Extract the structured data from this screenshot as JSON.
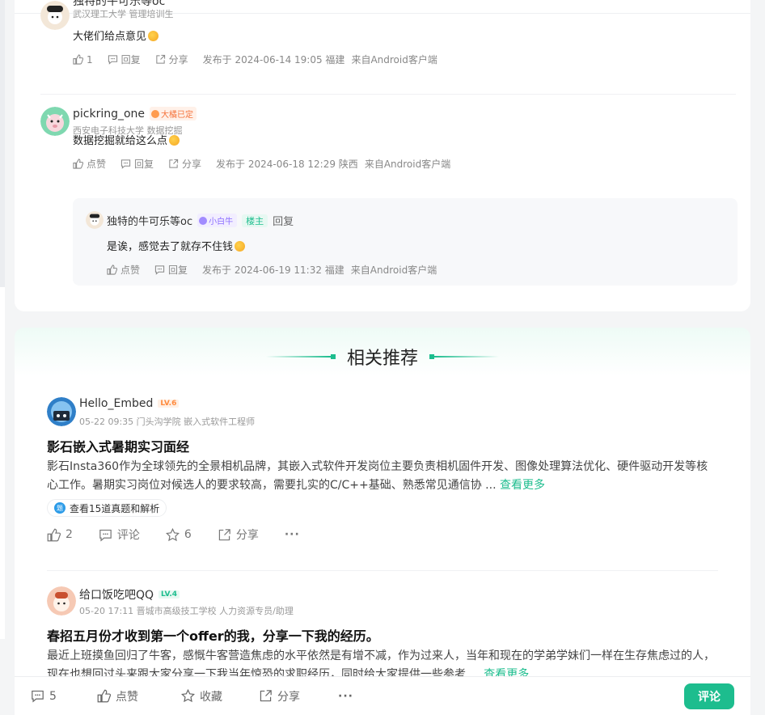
{
  "comments": [
    {
      "name": "独特的牛可乐等oc",
      "school": "武汉理工大学 管理培训生",
      "text": "大佬们给点意见",
      "likes": "1",
      "reply_label": "回复",
      "share_label": "分享",
      "published": "发布于 2024-06-14 19:05 福建",
      "source": "来自Android客户端"
    },
    {
      "name": "pickring_one",
      "badge": "大橘已定",
      "school": "西安电子科技大学 数据挖掘",
      "text": "数据挖掘就给这么点",
      "like_label": "点赞",
      "reply_label": "回复",
      "share_label": "分享",
      "published": "发布于 2024-06-18 12:29 陕西",
      "source": "来自Android客户端",
      "reply": {
        "name": "独特的牛可乐等oc",
        "badge": "小白牛",
        "host_tag": "楼主",
        "reply_word": "回复",
        "text": "是诶，感觉去了就存不住钱",
        "like_label": "点赞",
        "reply_label": "回复",
        "published": "发布于 2024-06-19 11:32 福建",
        "source": "来自Android客户端"
      }
    }
  ],
  "related": {
    "title": "相关推荐",
    "posts": [
      {
        "name": "Hello_Embed",
        "level": "LV.6",
        "meta": "05-22 09:35  门头沟学院 嵌入式软件工程师",
        "title": "影石嵌入式暑期实习面经",
        "body": "影石Insta360作为全球领先的全景相机品牌，其嵌入式软件开发岗位主要负责相机固件开发、图像处理算法优化、硬件驱动开发等核心工作。暑期实习岗位对候选人的要求较高，需要扎实的C/C++基础、熟悉常见通信协 ...",
        "more": "查看更多",
        "chip": "查看15道真题和解析",
        "likes": "2",
        "comment_label": "评论",
        "stars": "6",
        "share_label": "分享",
        "more_icon": "···"
      },
      {
        "name": "给口饭吃吧QQ",
        "level": "LV.4",
        "meta": "05-20 17:11  晋城市高级技工学校 人力资源专员/助理",
        "title": "春招五月份才收到第一个offer的我，分享一下我的经历。",
        "body": "最近上班摸鱼回归了牛客，感慨牛客营造焦虑的水平依然是有增不减，作为过来人，当年和现在的学弟学妹们一样在生存焦虑过的人，现在也想回过头来跟大家分享一下我当年惊恐的求职经历，同时给大家提供一些参考 ...",
        "more": "查看更多"
      }
    ]
  },
  "bottom_bar": {
    "comment_count": "5",
    "like_label": "点赞",
    "collect_label": "收藏",
    "share_label": "分享",
    "more_icon": "···",
    "comment_button": "评论"
  },
  "colors": {
    "accent": "#1dbd8e",
    "badge_orange": "#f5723a",
    "badge_purple": "#8a6cff"
  }
}
